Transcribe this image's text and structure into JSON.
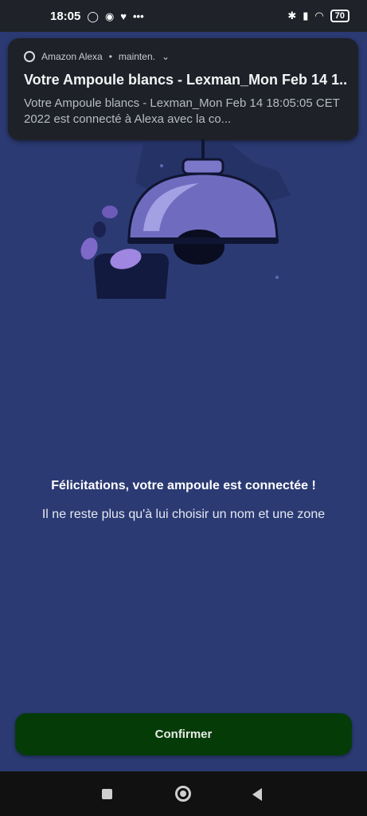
{
  "status_bar": {
    "time": "18:05",
    "battery": "70",
    "left_icons": [
      "circle-notification-icon",
      "messenger-icon",
      "twitter-icon",
      "more-icon"
    ],
    "right_icons": [
      "bluetooth-icon",
      "signal-icon",
      "wifi-icon",
      "battery-icon"
    ]
  },
  "notification": {
    "app_name": "Amazon Alexa",
    "separator": "•",
    "time": "mainten.",
    "title": "Votre Ampoule blancs - Lexman_Mon Feb 14 1..",
    "body": "Votre Ampoule blancs - Lexman_Mon Feb 14 18:05:05 CET 2022 est connecté à Alexa avec la co..."
  },
  "message": {
    "title": "Félicitations, votre ampoule est connectée !",
    "subtitle": "Il ne reste plus qu'à lui choisir un nom et une zone"
  },
  "confirm_button": {
    "label": "Confirmer"
  },
  "colors": {
    "background": "#2b3a73",
    "button": "#053b07",
    "notification": "#1e2127"
  }
}
